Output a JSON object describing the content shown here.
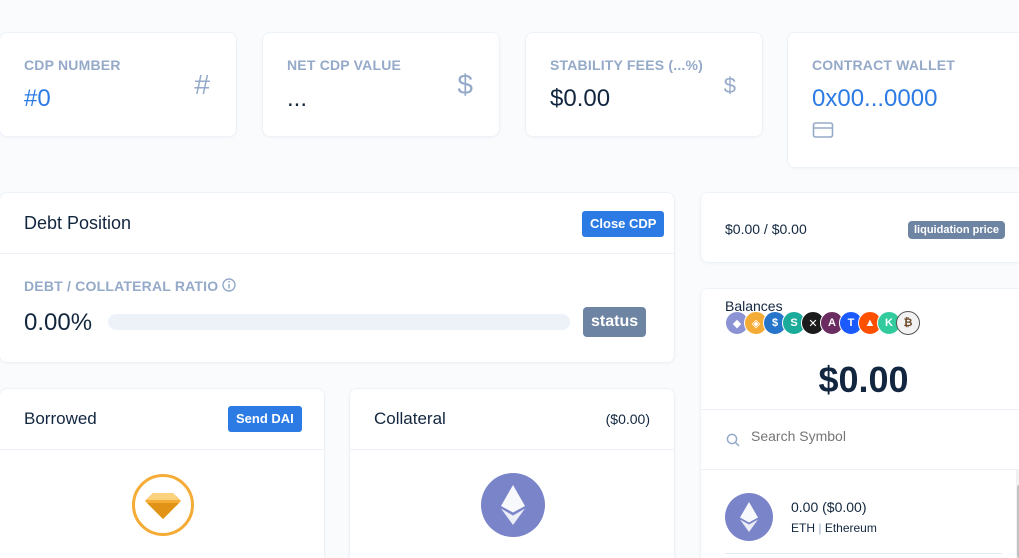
{
  "stats": [
    {
      "label": "CDP NUMBER",
      "value": "#0",
      "icon": "hash-icon",
      "icon_glyph": "#"
    },
    {
      "label": "NET CDP VALUE",
      "value": "...",
      "icon": "dollar-icon",
      "icon_glyph": "$"
    },
    {
      "label": "STABILITY FEES (...%)",
      "value": "$0.00",
      "icon": "dollar-icon",
      "icon_glyph": "$"
    },
    {
      "label": "CONTRACT WALLET",
      "value": "0x00...0000",
      "icon": "credit-card-icon"
    }
  ],
  "debt_position": {
    "title": "Debt Position",
    "close_button": "Close CDP",
    "ratio_label": "DEBT / COLLATERAL RATIO",
    "ratio_value": "0.00%",
    "ratio_fraction": 0,
    "status_label": "status"
  },
  "liquidation": {
    "value": "$0.00 / $0.00",
    "badge": "liquidation price"
  },
  "balances": {
    "title": "Balances",
    "total": "$0.00",
    "search_placeholder": "Search Symbol",
    "token_row": {
      "amount": "0.00 ($0.00)",
      "symbol": "ETH",
      "separator": "|",
      "name": "Ethereum"
    }
  },
  "borrowed": {
    "title": "Borrowed",
    "send_button": "Send DAI"
  },
  "collateral": {
    "title": "Collateral",
    "value": "($0.00)"
  },
  "colors": {
    "accent": "#2c7be5",
    "muted": "#95aac9",
    "eth": "#7a84c9",
    "dai": "#f5ac37",
    "badge": "#6e84a3"
  }
}
